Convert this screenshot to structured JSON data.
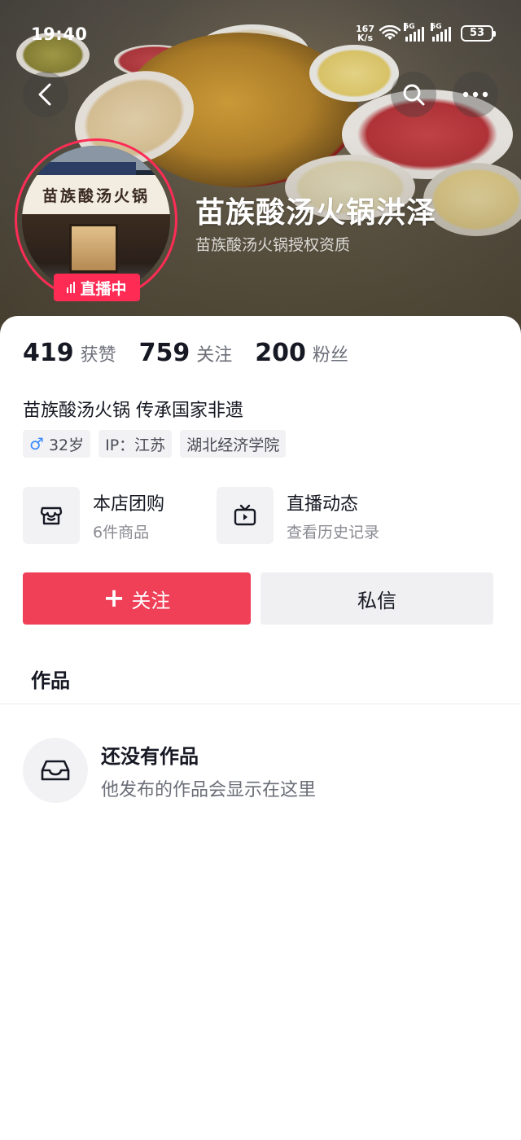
{
  "status_bar": {
    "time": "19:40",
    "net_speed_value": "167",
    "net_speed_unit": "K/s",
    "network_1": "5G",
    "network_2": "5G",
    "battery": "53"
  },
  "header": {
    "avatar_sign_text": "苗族酸汤火锅",
    "live_label": "直播中",
    "shop_name": "苗族酸汤火锅洪泽",
    "shop_subtitle": "苗族酸汤火锅授权资质"
  },
  "stats": [
    {
      "value": "419",
      "label": "获赞"
    },
    {
      "value": "759",
      "label": "关注"
    },
    {
      "value": "200",
      "label": "粉丝"
    }
  ],
  "profile": {
    "bio": "苗族酸汤火锅 传承国家非遗",
    "gender_symbol": "♂",
    "age": "32岁",
    "ip": "IP：江苏",
    "school": "湖北经济学院"
  },
  "services": [
    {
      "title": "本店团购",
      "subtitle": "6件商品",
      "icon": "store-icon"
    },
    {
      "title": "直播动态",
      "subtitle": "查看历史记录",
      "icon": "tv-icon"
    }
  ],
  "actions": {
    "follow_label": "关注",
    "follow_plus": "+",
    "message_label": "私信",
    "follow_color": "#EF4057"
  },
  "tabs": {
    "works": "作品"
  },
  "empty_state": {
    "title": "还没有作品",
    "subtitle": "他发布的作品会显示在这里",
    "icon": "inbox-icon"
  }
}
